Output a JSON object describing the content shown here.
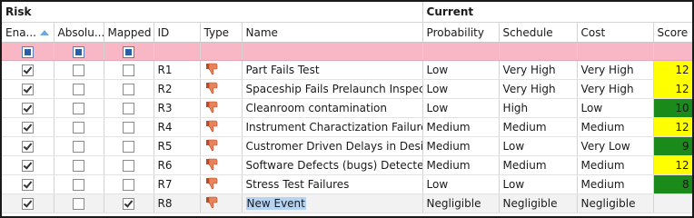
{
  "groups": {
    "risk": "Risk",
    "current": "Current"
  },
  "columns": {
    "enabled": "Ena...",
    "absolute": "Absolu...",
    "mapped": "Mapped",
    "id": "ID",
    "type": "Type",
    "name": "Name",
    "probability": "Probability",
    "schedule": "Schedule",
    "cost": "Cost",
    "score": "Score"
  },
  "colors": {
    "high": "#ffff00",
    "low": "#1a8a1a",
    "filter_row": "#f9b6c5",
    "selected_name": "#b7d3f2"
  },
  "rows": [
    {
      "id": "R1",
      "name": "Part Fails Test",
      "probability": "Low",
      "schedule": "Very High",
      "cost": "Very High",
      "score": "12",
      "level": "high",
      "enabled": true,
      "absolute": false,
      "mapped": false
    },
    {
      "id": "R2",
      "name": "Spaceship Fails Prelaunch Inspecti...",
      "probability": "Low",
      "schedule": "Very High",
      "cost": "Very High",
      "score": "12",
      "level": "high",
      "enabled": true,
      "absolute": false,
      "mapped": false
    },
    {
      "id": "R3",
      "name": "Cleanroom contamination",
      "probability": "Low",
      "schedule": "High",
      "cost": "Low",
      "score": "10",
      "level": "low",
      "enabled": true,
      "absolute": false,
      "mapped": false
    },
    {
      "id": "R4",
      "name": "Instrument Charactization Failure",
      "probability": "Medium",
      "schedule": "Medium",
      "cost": "Medium",
      "score": "12",
      "level": "high",
      "enabled": true,
      "absolute": false,
      "mapped": false
    },
    {
      "id": "R5",
      "name": "Custromer Driven Delays in Desig...",
      "probability": "Medium",
      "schedule": "Low",
      "cost": "Very Low",
      "score": "9",
      "level": "low",
      "enabled": true,
      "absolute": false,
      "mapped": false
    },
    {
      "id": "R6",
      "name": "Software Defects (bugs) Detected",
      "probability": "Medium",
      "schedule": "Medium",
      "cost": "Medium",
      "score": "12",
      "level": "high",
      "enabled": true,
      "absolute": false,
      "mapped": false
    },
    {
      "id": "R7",
      "name": "Stress Test Failures",
      "probability": "Low",
      "schedule": "Low",
      "cost": "Medium",
      "score": "8",
      "level": "low",
      "enabled": true,
      "absolute": false,
      "mapped": false
    },
    {
      "id": "R8",
      "name": "New Event",
      "probability": "Negligible",
      "schedule": "Negligible",
      "cost": "Negligible",
      "score": "",
      "level": "none",
      "enabled": true,
      "absolute": false,
      "mapped": true,
      "selected": true
    }
  ],
  "icons": {
    "type": "thumbs-down-icon",
    "sort": "sort-ascending-icon"
  }
}
